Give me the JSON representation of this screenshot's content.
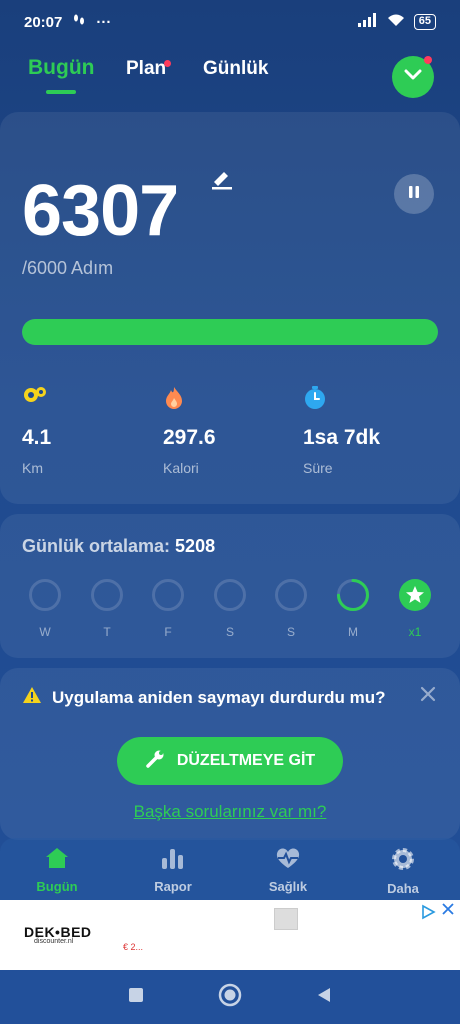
{
  "status": {
    "time": "20:07",
    "extra": "···",
    "battery": "65"
  },
  "tabs": {
    "today": "Bugün",
    "plan": "Plan",
    "daily": "Günlük"
  },
  "steps": {
    "count": "6307",
    "goal_text": "/6000 Adım",
    "progress_fraction": 1.0
  },
  "stats": [
    {
      "icon": "map-pin-icon",
      "value": "4.1",
      "label": "Km",
      "color": "#f5d31c"
    },
    {
      "icon": "flame-icon",
      "value": "297.6",
      "label": "Kalori",
      "color": "#ff8a50"
    },
    {
      "icon": "stopwatch-icon",
      "value": "1sa 7dk",
      "label": "Süre",
      "color": "#2ea8f0"
    }
  ],
  "weekly": {
    "avg_label": "Günlük ortalama:",
    "avg_value": "5208",
    "days": [
      {
        "label": "W",
        "state": "empty"
      },
      {
        "label": "T",
        "state": "empty"
      },
      {
        "label": "F",
        "state": "empty"
      },
      {
        "label": "S",
        "state": "empty"
      },
      {
        "label": "S",
        "state": "empty"
      },
      {
        "label": "M",
        "state": "partial"
      },
      {
        "label": "x1",
        "state": "star"
      }
    ]
  },
  "help": {
    "question": "Uygulama aniden saymayı durdurdu mu?",
    "fix_button": "DÜZELTMEYE GİT",
    "more_link": "Başka sorularınız var mı?"
  },
  "bottom_nav": [
    {
      "icon": "home-icon",
      "label": "Bugün",
      "active": true
    },
    {
      "icon": "bar-chart-icon",
      "label": "Rapor",
      "active": false
    },
    {
      "icon": "heart-pulse-icon",
      "label": "Sağlık",
      "active": false
    },
    {
      "icon": "gear-icon",
      "label": "Daha",
      "active": false
    }
  ],
  "ad": {
    "brand": "DEK•BED",
    "sub": "discounter.nl",
    "price": "€ 2..."
  },
  "colors": {
    "accent": "#2ecc55",
    "background": "#1f4a8e",
    "alert_dot": "#ff3b5c"
  }
}
